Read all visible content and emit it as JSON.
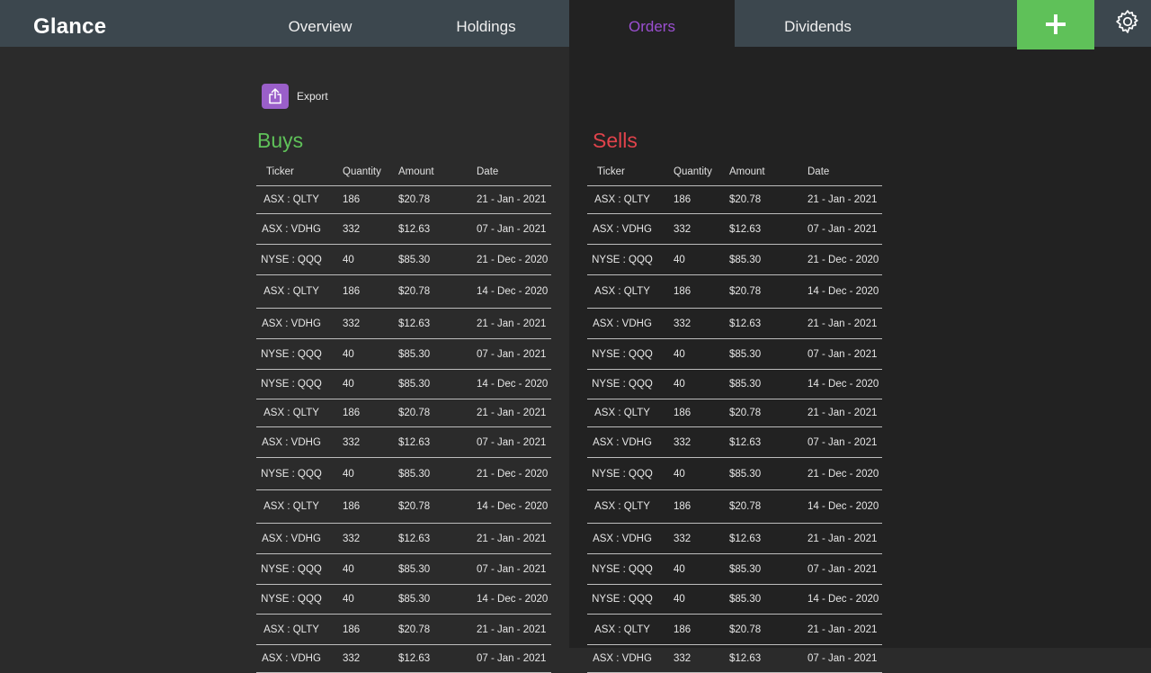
{
  "app": {
    "name": "Glance"
  },
  "nav": {
    "tabs": [
      {
        "label": "Overview"
      },
      {
        "label": "Holdings"
      },
      {
        "label": "Orders"
      },
      {
        "label": "Dividends"
      }
    ],
    "active_tab": "Orders",
    "add_icon": "plus-icon",
    "settings_icon": "gear-icon"
  },
  "toolbar": {
    "export_label": "Export",
    "export_icon": "share-export-icon"
  },
  "colors": {
    "buys": "#5fc159",
    "sells": "#e0434b",
    "active_tab": "#9b4fd1",
    "export_button": "#9a5fc9",
    "add_button": "#5fc159"
  },
  "buys": {
    "title": "Buys",
    "headers": [
      "Ticker",
      "Quantity",
      "Amount",
      "Date"
    ],
    "rows": [
      [
        "ASX : QLTY",
        "186",
        "$20.78",
        "21 - Jan - 2021"
      ],
      [
        "ASX : VDHG",
        "332",
        "$12.63",
        "07 - Jan - 2021"
      ],
      [
        "NYSE : QQQ",
        "40",
        "$85.30",
        "21 - Dec - 2020"
      ],
      [
        "ASX : QLTY",
        "186",
        "$20.78",
        "14 - Dec - 2020"
      ],
      [
        "ASX : VDHG",
        "332",
        "$12.63",
        "21 - Jan - 2021"
      ],
      [
        "NYSE : QQQ",
        "40",
        "$85.30",
        "07 - Jan - 2021"
      ],
      [
        "NYSE : QQQ",
        "40",
        "$85.30",
        "14 - Dec - 2020"
      ],
      [
        "ASX : QLTY",
        "186",
        "$20.78",
        "21 - Jan - 2021"
      ],
      [
        "ASX : VDHG",
        "332",
        "$12.63",
        "07 - Jan - 2021"
      ],
      [
        "NYSE : QQQ",
        "40",
        "$85.30",
        "21 - Dec - 2020"
      ],
      [
        "ASX : QLTY",
        "186",
        "$20.78",
        "14 - Dec - 2020"
      ],
      [
        "ASX : VDHG",
        "332",
        "$12.63",
        "21 - Jan - 2021"
      ],
      [
        "NYSE : QQQ",
        "40",
        "$85.30",
        "07 - Jan - 2021"
      ],
      [
        "NYSE : QQQ",
        "40",
        "$85.30",
        "14 - Dec - 2020"
      ],
      [
        "ASX : QLTY",
        "186",
        "$20.78",
        "21 - Jan - 2021"
      ],
      [
        "ASX : VDHG",
        "332",
        "$12.63",
        "07 - Jan - 2021"
      ]
    ]
  },
  "sells": {
    "title": "Sells",
    "headers": [
      "Ticker",
      "Quantity",
      "Amount",
      "Date"
    ],
    "rows": [
      [
        "ASX : QLTY",
        "186",
        "$20.78",
        "21 - Jan - 2021"
      ],
      [
        "ASX : VDHG",
        "332",
        "$12.63",
        "07 - Jan - 2021"
      ],
      [
        "NYSE : QQQ",
        "40",
        "$85.30",
        "21 - Dec - 2020"
      ],
      [
        "ASX : QLTY",
        "186",
        "$20.78",
        "14 - Dec - 2020"
      ],
      [
        "ASX : VDHG",
        "332",
        "$12.63",
        "21 - Jan - 2021"
      ],
      [
        "NYSE : QQQ",
        "40",
        "$85.30",
        "07 - Jan - 2021"
      ],
      [
        "NYSE : QQQ",
        "40",
        "$85.30",
        "14 - Dec - 2020"
      ],
      [
        "ASX : QLTY",
        "186",
        "$20.78",
        "21 - Jan - 2021"
      ],
      [
        "ASX : VDHG",
        "332",
        "$12.63",
        "07 - Jan - 2021"
      ],
      [
        "NYSE : QQQ",
        "40",
        "$85.30",
        "21 - Dec - 2020"
      ],
      [
        "ASX : QLTY",
        "186",
        "$20.78",
        "14 - Dec - 2020"
      ],
      [
        "ASX : VDHG",
        "332",
        "$12.63",
        "21 - Jan - 2021"
      ],
      [
        "NYSE : QQQ",
        "40",
        "$85.30",
        "07 - Jan - 2021"
      ],
      [
        "NYSE : QQQ",
        "40",
        "$85.30",
        "14 - Dec - 2020"
      ],
      [
        "ASX : QLTY",
        "186",
        "$20.78",
        "21 - Jan - 2021"
      ],
      [
        "ASX : VDHG",
        "332",
        "$12.63",
        "07 - Jan - 2021"
      ]
    ]
  }
}
